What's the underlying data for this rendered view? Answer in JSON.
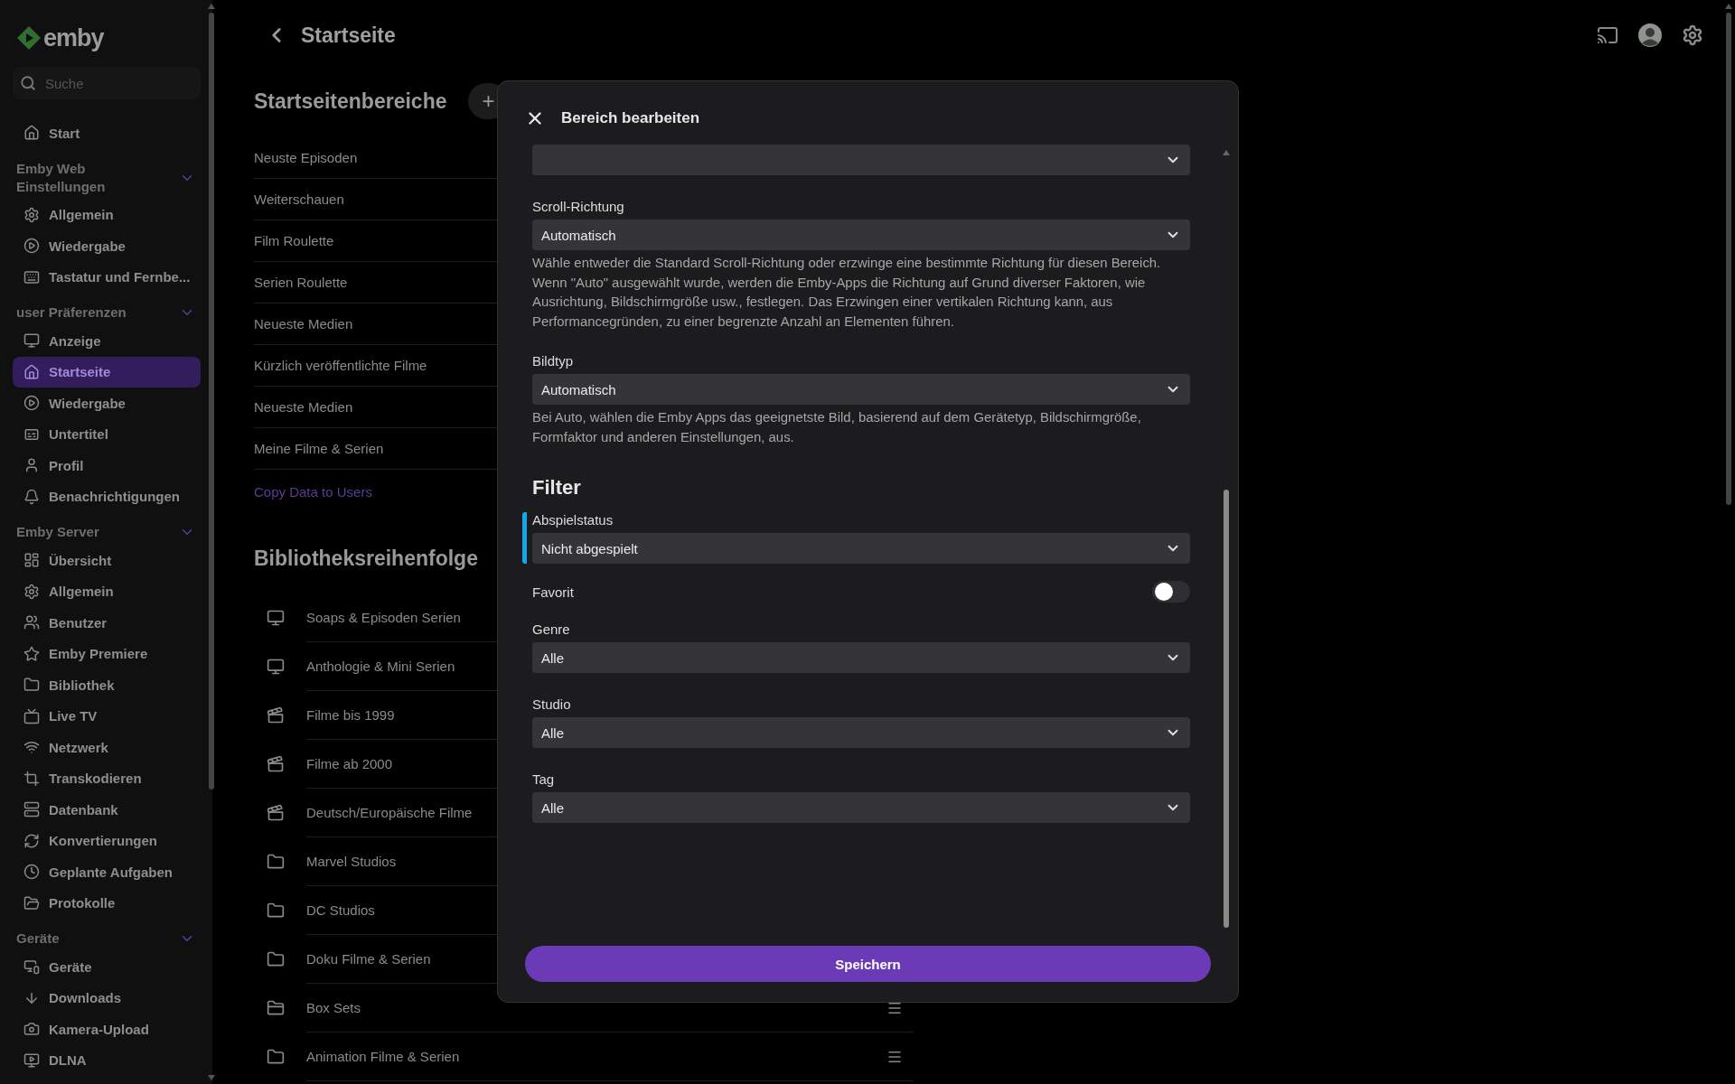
{
  "sidebar": {
    "logo": "emby",
    "search": {
      "placeholder": "Suche"
    },
    "top_items": [
      {
        "label": "Start",
        "selected": false
      }
    ],
    "groups": [
      {
        "title": "Emby Web Einstellungen",
        "expanded": true,
        "items": [
          {
            "label": "Allgemein",
            "selected": false
          },
          {
            "label": "Wiedergabe",
            "selected": false
          },
          {
            "label": "Tastatur und Fernbe...",
            "selected": false
          }
        ]
      },
      {
        "title": "user Präferenzen",
        "expanded": true,
        "items": [
          {
            "label": "Anzeige",
            "selected": false
          },
          {
            "label": "Startseite",
            "selected": true
          },
          {
            "label": "Wiedergabe",
            "selected": false
          },
          {
            "label": "Untertitel",
            "selected": false
          },
          {
            "label": "Profil",
            "selected": false
          },
          {
            "label": "Benachrichtigungen",
            "selected": false
          }
        ]
      },
      {
        "title": "Emby Server",
        "expanded": true,
        "items": [
          {
            "label": "Übersicht",
            "selected": false
          },
          {
            "label": "Allgemein",
            "selected": false
          },
          {
            "label": "Benutzer",
            "selected": false
          },
          {
            "label": "Emby Premiere",
            "selected": false
          },
          {
            "label": "Bibliothek",
            "selected": false
          },
          {
            "label": "Live TV",
            "selected": false
          },
          {
            "label": "Netzwerk",
            "selected": false
          },
          {
            "label": "Transkodieren",
            "selected": false
          },
          {
            "label": "Datenbank",
            "selected": false
          },
          {
            "label": "Konvertierungen",
            "selected": false
          },
          {
            "label": "Geplante Aufgaben",
            "selected": false
          },
          {
            "label": "Protokolle",
            "selected": false
          }
        ]
      },
      {
        "title": "Geräte",
        "expanded": true,
        "items": [
          {
            "label": "Geräte",
            "selected": false
          },
          {
            "label": "Downloads",
            "selected": false
          },
          {
            "label": "Kamera-Upload",
            "selected": false
          },
          {
            "label": "DLNA",
            "selected": false
          }
        ]
      }
    ]
  },
  "header": {
    "title": "Startseite"
  },
  "home_sections": {
    "title": "Startseitenbereiche",
    "add_button": "+",
    "rows": [
      "Neuste Episoden",
      "Weiterschauen",
      "Film Roulette",
      "Serien Roulette",
      "Neueste Medien",
      "Kürzlich veröffentlichte Filme",
      "Neueste Medien",
      "Meine Filme & Serien"
    ],
    "link": "Copy Data to Users"
  },
  "library_order": {
    "title": "Bibliotheksreihenfolge",
    "rows": [
      {
        "label": "Soaps & Episoden Serien",
        "kind": "tv"
      },
      {
        "label": "Anthologie & Mini Serien",
        "kind": "tv"
      },
      {
        "label": "Filme bis 1999",
        "kind": "movies"
      },
      {
        "label": "Filme ab 2000",
        "kind": "movies"
      },
      {
        "label": "Deutsch/Europäische Filme",
        "kind": "movies"
      },
      {
        "label": "Marvel Studios",
        "kind": "folder"
      },
      {
        "label": "DC Studios",
        "kind": "folder"
      },
      {
        "label": "Doku Filme & Serien",
        "kind": "folder"
      },
      {
        "label": "Box Sets",
        "kind": "boxsets"
      },
      {
        "label": "Animation Filme & Serien",
        "kind": "folder"
      }
    ]
  },
  "dialog": {
    "title": "Bereich bearbeiten",
    "fields": [
      {
        "kind": "select",
        "focused": false
      },
      {
        "kind": "select",
        "label": "Scroll-Richtung",
        "value": "Automatisch",
        "focused": false,
        "help": "Wähle entweder die Standard Scroll-Richtung oder erzwinge eine bestimmte Richtung für diesen Bereich. Wenn \"Auto\" ausgewählt wurde, werden die Emby-Apps die Richtung auf Grund diverser Faktoren, wie Ausrichtung, Bildschirmgröße usw., festlegen. Das Erzwingen einer vertikalen Richtung kann, aus Performancegründen, zu einer begrenzte Anzahl an Elementen führen."
      },
      {
        "kind": "select",
        "label": "Bildtyp",
        "value": "Automatisch",
        "focused": false,
        "help": "Bei Auto, wählen die Emby Apps das geeignetste Bild, basierend auf dem Gerätetyp, Bildschirmgröße, Formfaktor und anderen Einstellungen, aus."
      },
      {
        "kind": "heading",
        "text": "Filter"
      },
      {
        "kind": "select",
        "label": "Abspielstatus",
        "value": "Nicht abgespielt",
        "focused": true
      },
      {
        "kind": "toggle",
        "label": "Favorit",
        "on": false
      },
      {
        "kind": "select",
        "label": "Genre",
        "value": "Alle",
        "focused": false
      },
      {
        "kind": "select",
        "label": "Studio",
        "value": "Alle",
        "focused": false
      },
      {
        "kind": "select",
        "label": "Tag",
        "value": "Alle",
        "focused": false
      }
    ],
    "save_button": "Speichern"
  }
}
